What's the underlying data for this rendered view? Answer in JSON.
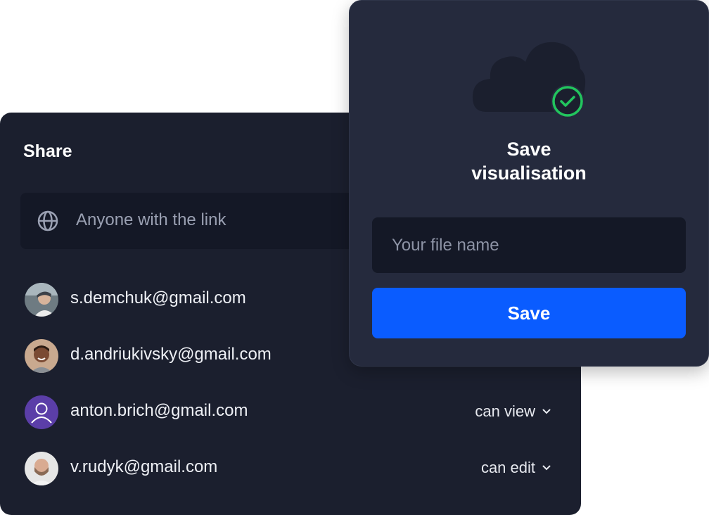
{
  "share": {
    "title": "Share",
    "link_access": "Anyone with the link",
    "users": [
      {
        "email": "s.demchuk@gmail.com",
        "permission": ""
      },
      {
        "email": "d.andriukivsky@gmail.com",
        "permission": ""
      },
      {
        "email": "anton.brich@gmail.com",
        "permission": "can view"
      },
      {
        "email": "v.rudyk@gmail.com",
        "permission": "can edit"
      }
    ]
  },
  "save_dialog": {
    "title_line1": "Save",
    "title_line2": "visualisation",
    "file_name_placeholder": "Your file name",
    "file_name_value": "",
    "save_label": "Save"
  },
  "colors": {
    "panel_bg": "#1b1f2e",
    "dialog_bg": "#252a3d",
    "input_bg": "#141826",
    "accent": "#0a5cff",
    "success": "#22c55e",
    "avatar_purple": "#5b3ea8"
  },
  "icons": [
    "globe-icon",
    "cloud-icon",
    "check-circle-icon",
    "chevron-down-icon",
    "user-icon"
  ]
}
